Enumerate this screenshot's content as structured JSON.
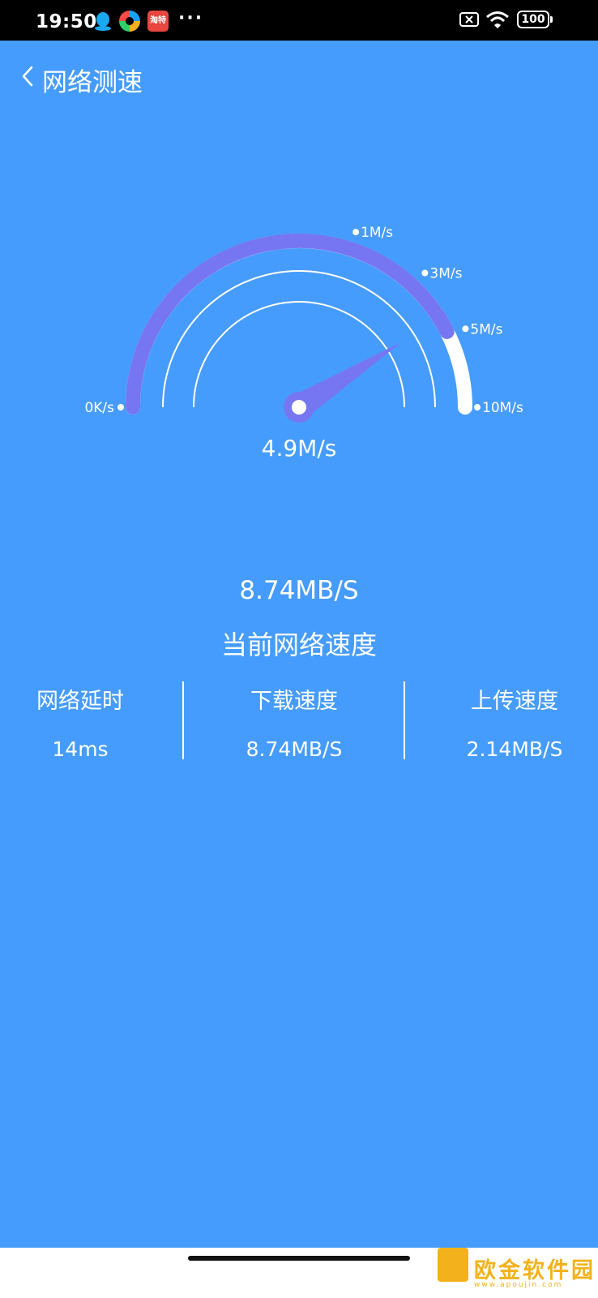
{
  "status_bar": {
    "time": "19:50",
    "battery": "100"
  },
  "header": {
    "title": "网络测速"
  },
  "gauge": {
    "current_value": "4.9M/s",
    "ticks": [
      "0K/s",
      "1M/s",
      "3M/s",
      "5M/s",
      "10M/s"
    ],
    "level_fraction": 0.85,
    "needle_fraction": 0.82
  },
  "summary": {
    "speed": "8.74MB/S",
    "label": "当前网络速度"
  },
  "stats": [
    {
      "label": "网络延时",
      "value": "14ms"
    },
    {
      "label": "下载速度",
      "value": "8.74MB/S"
    },
    {
      "label": "上传速度",
      "value": "2.14MB/S"
    }
  ],
  "watermark": {
    "text": "欧金软件园",
    "url": "www.apoujin.com"
  },
  "colors": {
    "background": "#469cfc",
    "gauge_fill": "#7776f2",
    "track": "#ffffff"
  }
}
